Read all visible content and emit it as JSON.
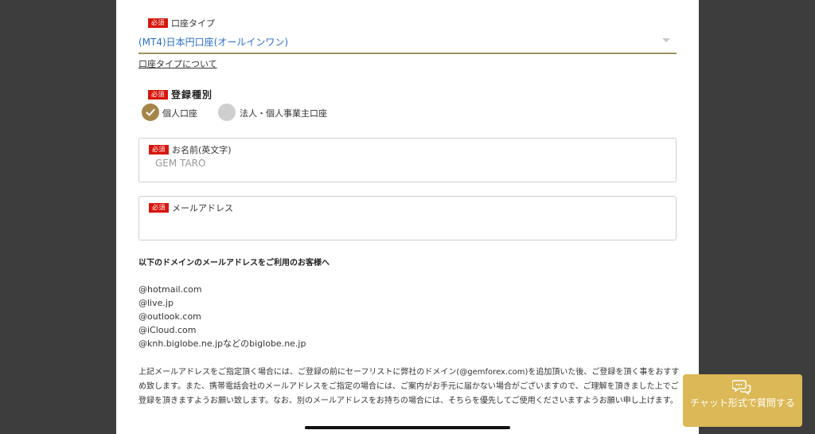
{
  "form": {
    "required_badge": "必須",
    "account_type": {
      "label": "口座タイプ",
      "selected_value": "(MT4)日本円口座(オールインワン)",
      "about_link": "口座タイプについて"
    },
    "registration_type": {
      "label": "登録種別",
      "options": [
        {
          "label": "個人口座",
          "selected": true
        },
        {
          "label": "法人・個人事業主口座",
          "selected": false
        }
      ]
    },
    "name_field": {
      "label": "お名前(英文字)",
      "placeholder": "GEM TARO",
      "value": ""
    },
    "email_field": {
      "label": "メールアドレス",
      "placeholder": "",
      "value": ""
    }
  },
  "notice": {
    "title": "以下のドメインのメールアドレスをご利用のお客様へ",
    "domains": [
      "@hotmail.com",
      "@live.jp",
      "@outlook.com",
      "@iCloud.com",
      "@knh.biglobe.ne.jpなどのbiglobe.ne.jp"
    ],
    "paragraph": "上記メールアドレスをご指定頂く場合には、ご登録の前にセーフリストに弊社のドメイン(@gemforex.com)を追加頂いた後、ご登録を頂く事をおすすめ致します。また、携帯電話会社のメールアドレスをご指定の場合には、ご案内がお手元に届かない場合がございますので、ご理解を頂きました上でご登録を頂きますようお願い致します。なお、別のメールアドレスをお持ちの場合には、そちらを優先してご使用くださいますようお願い申し上げます。"
  },
  "chat": {
    "label": "チャット形式で質問する",
    "icon": "chat-bubbles-icon"
  },
  "colors": {
    "required_badge": "#d7160d",
    "selected_value": "#2a6fc9",
    "radio_selected": "#a5864a",
    "radio_unselected": "#cfcfcf",
    "chat_button": "#dcb856",
    "side_background": "#3d3d3d"
  }
}
